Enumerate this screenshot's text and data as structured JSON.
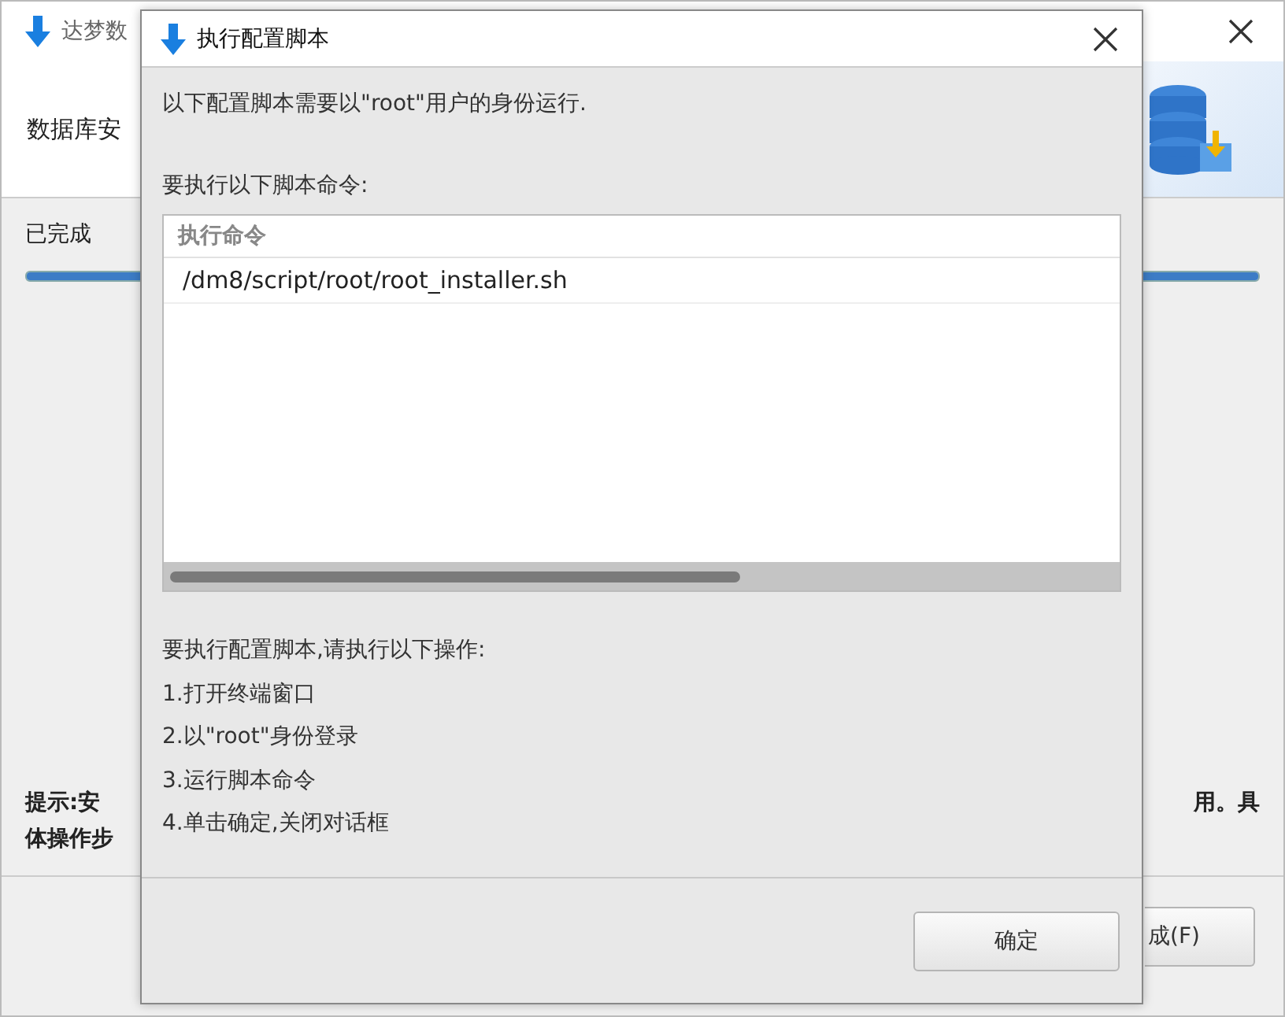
{
  "background_window": {
    "title": "达梦数",
    "header": "数据库安",
    "status": "已完成",
    "progress": {
      "level": 1
    },
    "tip_left": [
      "提示:安",
      "体操作步"
    ],
    "tip_right": "用。具",
    "finish_button": "成(F)"
  },
  "dialog": {
    "title": "执行配置脚本",
    "intro": "以下配置脚本需要以\"root\"用户的身份运行.",
    "commands_label": "要执行以下脚本命令:",
    "table": {
      "columns": [
        "执行命令"
      ],
      "rows": [
        [
          "/dm8/script/root/root_installer.sh"
        ]
      ]
    },
    "instructions_heading": "要执行配置脚本,请执行以下操作:",
    "steps": [
      "1.打开终端窗口",
      "2.以\"root\"身份登录",
      "3.运行脚本命令",
      "4.单击确定,关闭对话框"
    ],
    "ok_button": "确定"
  }
}
